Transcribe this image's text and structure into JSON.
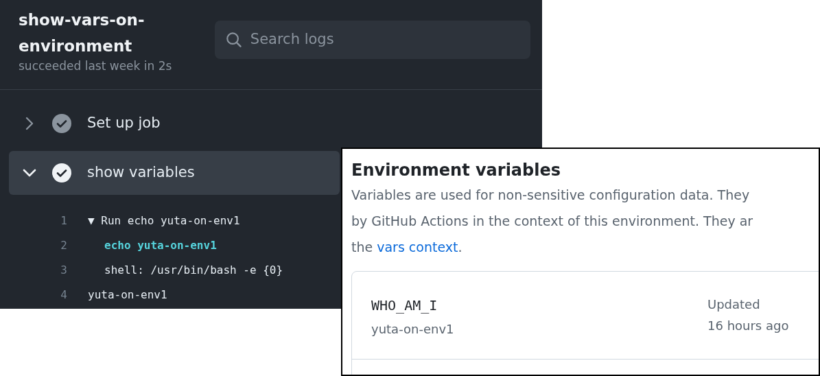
{
  "job": {
    "title": "show-vars-on-environment",
    "subtitle": "succeeded last week in 2s"
  },
  "search": {
    "placeholder": "Search logs"
  },
  "steps": [
    {
      "label": "Set up job",
      "expanded": false
    },
    {
      "label": "show variables",
      "expanded": true
    }
  ],
  "log_lines": [
    {
      "number": "1",
      "text": "▼ Run echo yuta-on-env1",
      "kind": "group"
    },
    {
      "number": "2",
      "text": "echo yuta-on-env1",
      "kind": "command"
    },
    {
      "number": "3",
      "text": "shell: /usr/bin/bash -e {0}",
      "kind": "detail"
    },
    {
      "number": "4",
      "text": "yuta-on-env1",
      "kind": "output"
    }
  ],
  "environment_variables": {
    "title": "Environment variables",
    "description_lines": [
      "Variables are used for non-sensitive configuration data. They",
      "by GitHub Actions in the context of this environment. They ar"
    ],
    "description_prefix": "the ",
    "link": "vars context",
    "description_suffix": ".",
    "variables": [
      {
        "name": "WHO_AM_I",
        "value": "yuta-on-env1",
        "updated_label": "Updated",
        "updated_time": "16 hours ago"
      }
    ]
  }
}
